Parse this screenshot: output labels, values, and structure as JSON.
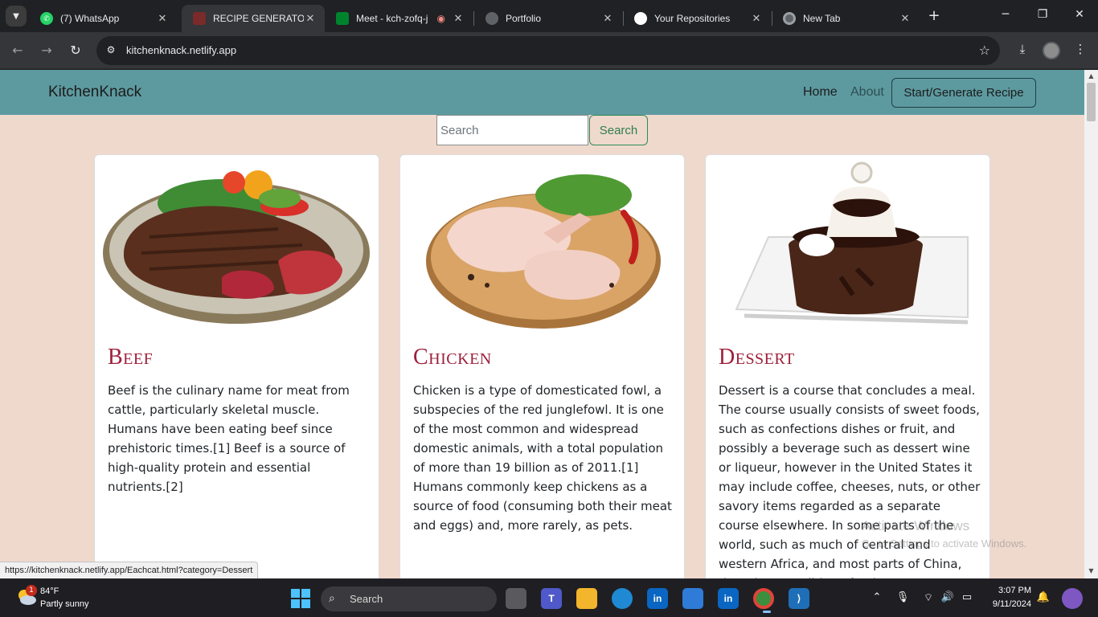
{
  "browser": {
    "tabs": [
      {
        "title": "(7) WhatsApp",
        "icon": "whatsapp-icon",
        "color": "#25d366"
      },
      {
        "title": "RECIPE GENERATOR",
        "icon": "recipe-icon",
        "color": "#7a2a2a"
      },
      {
        "title": "Meet - kch-zofq-j",
        "icon": "meet-icon",
        "color": "#00832d"
      },
      {
        "title": "Portfolio",
        "icon": "globe-icon",
        "color": "#5f6368"
      },
      {
        "title": "Your Repositories",
        "icon": "github-icon",
        "color": "#ffffff"
      },
      {
        "title": "New Tab",
        "icon": "chrome-icon",
        "color": "#5f6368"
      }
    ],
    "url": "kitchenknack.netlify.app",
    "status_url": "https://kitchenknack.netlify.app/Eachcat.html?category=Dessert"
  },
  "site": {
    "brand": "KitchenKnack",
    "nav": {
      "home": "Home",
      "about": "About",
      "start": "Start/Generate Recipe"
    },
    "search": {
      "placeholder": "Search",
      "button": "Search"
    },
    "cards": [
      {
        "title": "Beef",
        "text": "Beef is the culinary name for meat from cattle, particularly skeletal muscle. Humans have been eating beef since prehistoric times.[1] Beef is a source of high-quality protein and essential nutrients.[2]"
      },
      {
        "title": "Chicken",
        "text": "Chicken is a type of domesticated fowl, a subspecies of the red junglefowl. It is one of the most common and widespread domestic animals, with a total population of more than 19 billion as of 2011.[1] Humans commonly keep chickens as a source of food (consuming both their meat and eggs) and, more rarely, as pets."
      },
      {
        "title": "Dessert",
        "text": "Dessert is a course that concludes a meal. The course usually consists of sweet foods, such as confections dishes or fruit, and possibly a beverage such as dessert wine or liqueur, however in the United States it may include coffee, cheeses, nuts, or other savory items regarded as a separate course elsewhere. In some parts of the world, such as much of central and western Africa, and most parts of China, there is no tradition of a dessert course to conclude a meal. The term"
      }
    ],
    "colors": {
      "navbar": "#5d9aa0",
      "page_bg": "#efd9cd",
      "card_title": "#9e1f3a"
    }
  },
  "watermark": {
    "line1": "Activate Windows",
    "line2": "Go to Settings to activate Windows."
  },
  "taskbar": {
    "weather_temp": "84°F",
    "weather_desc": "Partly sunny",
    "weather_badge": "1",
    "search_label": "Search",
    "time": "3:07 PM",
    "date": "9/11/2024"
  }
}
